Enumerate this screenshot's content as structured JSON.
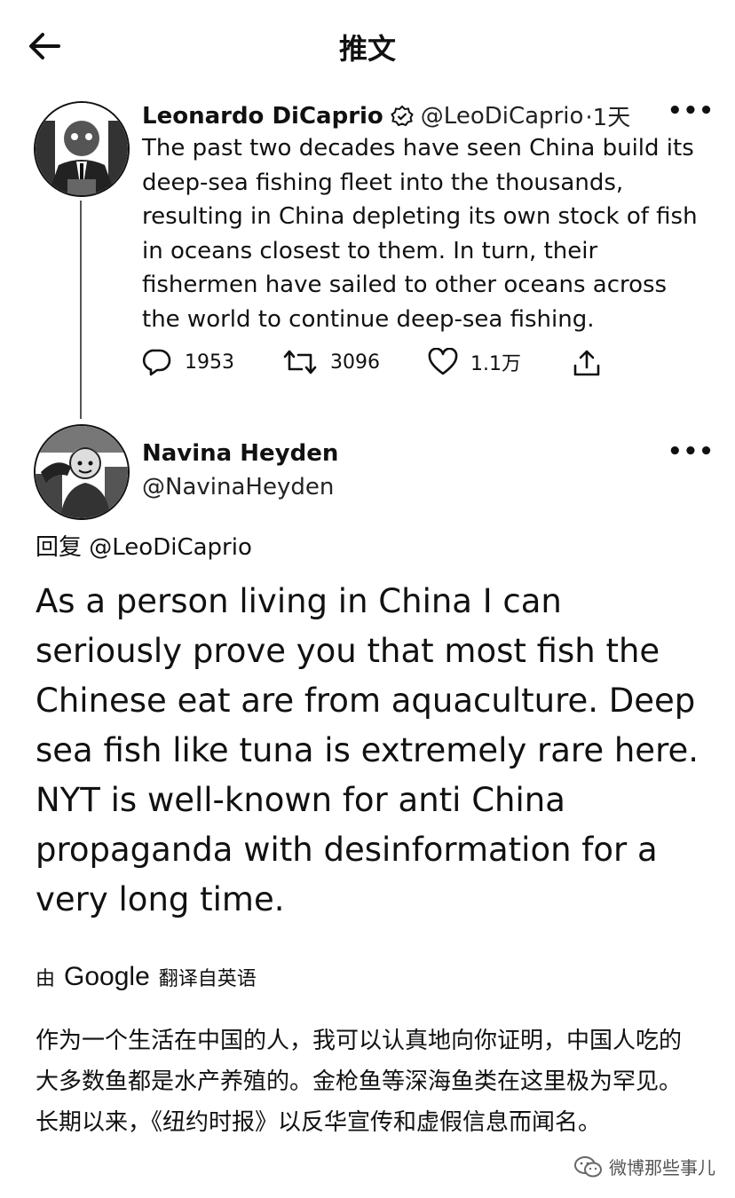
{
  "header": {
    "title": "推文"
  },
  "tweet": {
    "author_name": "Leonardo DiCaprio",
    "handle": "@LeoDiCaprio",
    "time": "·1天",
    "text": "The past two decades have seen China build its deep-sea fishing fleet into the thousands, resulting in China depleting its own stock of fish in oceans closest to them. In turn, their fishermen have sailed to other oceans across the world to continue deep-sea fishing.",
    "replies": "1953",
    "retweets": "3096",
    "likes": "1.1万"
  },
  "reply": {
    "author_name": "Navina Heyden",
    "handle": "@NavinaHeyden",
    "reply_prefix": "回复",
    "reply_to": "@LeoDiCaprio",
    "text": "As a person living in China I can seriously prove you that most fish the Chinese eat are from aquaculture. Deep sea fish like tuna is extremely rare here. NYT is well-known for anti China propaganda with desinformation for a very long time.",
    "translated_prefix": "由",
    "translator": "Google",
    "translated_suffix": "翻译自英语",
    "translation": "作为一个生活在中国的人，我可以认真地向你证明，中国人吃的大多数鱼都是水产养殖的。金枪鱼等深海鱼类在这里极为罕见。长期以来，《纽约时报》以反华宣传和虚假信息而闻名。"
  },
  "watermark": {
    "text": "微博那些事儿"
  },
  "icons": [
    "back-arrow-icon",
    "verified-badge-icon",
    "more-icon",
    "reply-icon",
    "retweet-icon",
    "like-icon",
    "share-icon",
    "wechat-icon"
  ]
}
